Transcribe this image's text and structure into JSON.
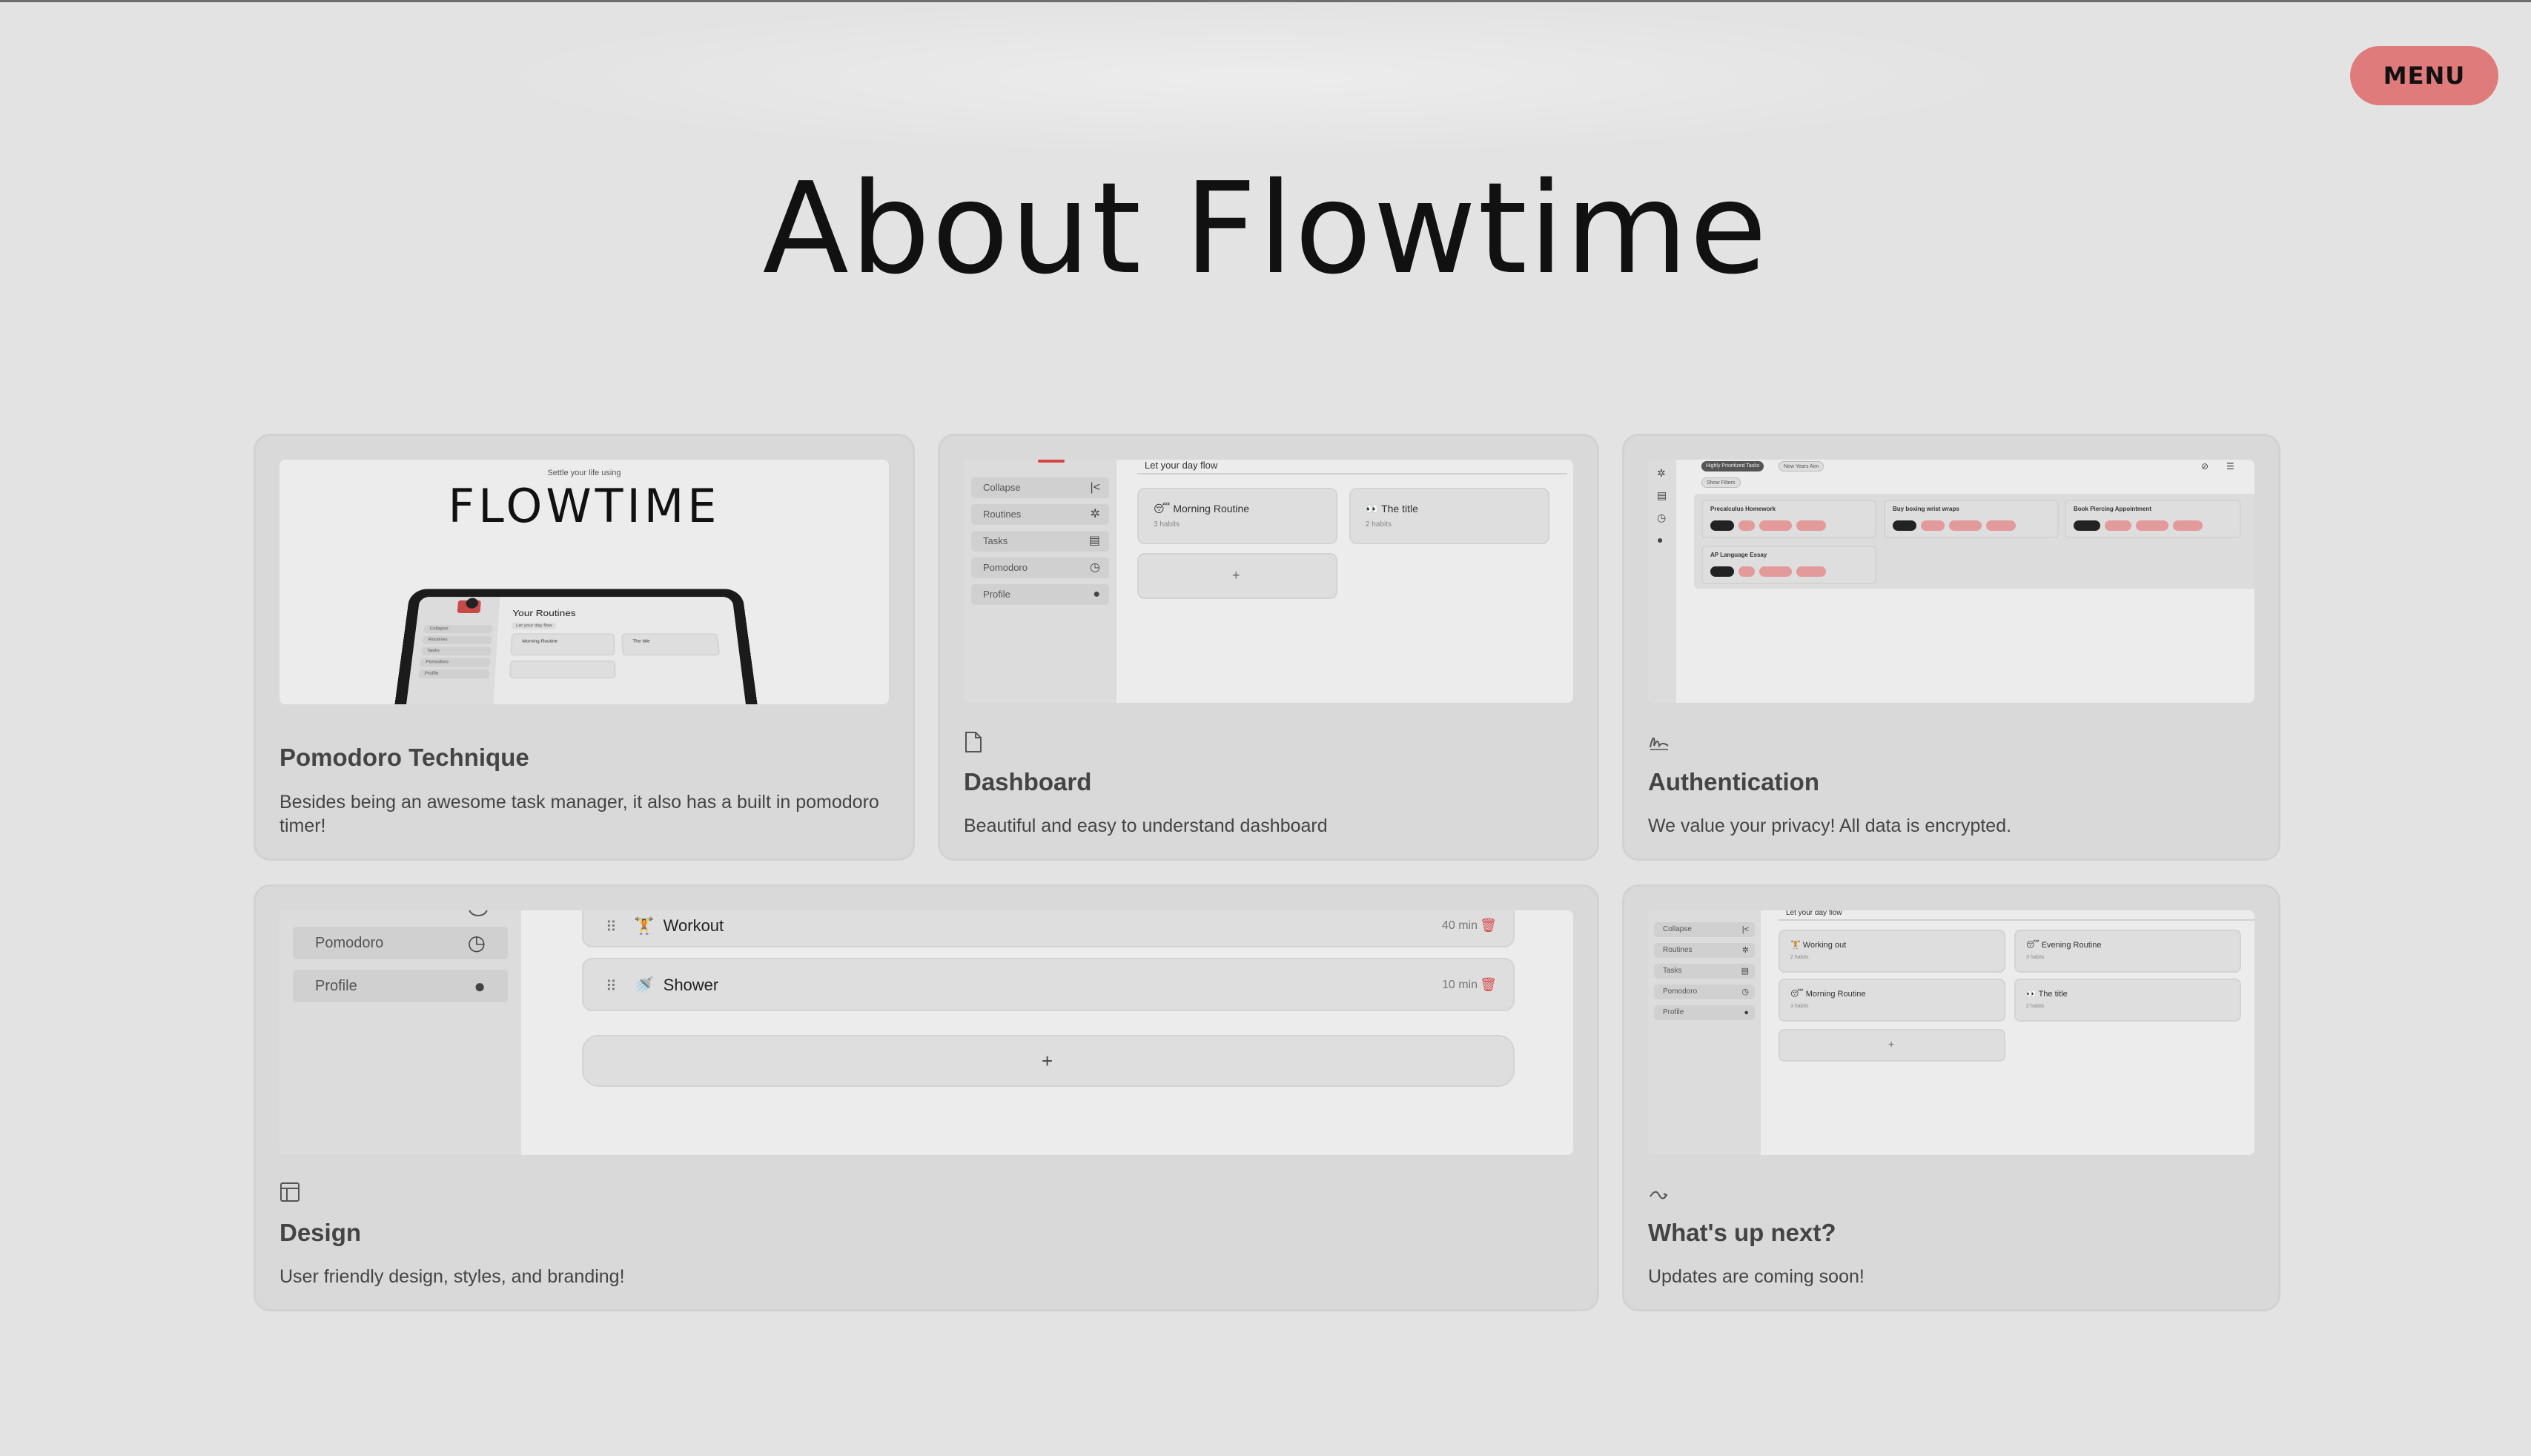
{
  "header": {
    "menu_label": "MENU",
    "title": "About Flowtime"
  },
  "colors": {
    "background": "#e3e3e3",
    "card": "#d9d9d9",
    "menu_button": "#e07b7b",
    "accent_red": "#d64545"
  },
  "cards": [
    {
      "title": "Pomodoro Technique",
      "description": "Besides being an awesome task manager, it also has a built in pomodoro timer!",
      "preview": {
        "tagline": "Settle your life using",
        "brand": "FLOWTIME",
        "screen_title": "Your Routines",
        "screen_subtitle": "Let your day flow",
        "sidebar": [
          "Collapse",
          "Routines",
          "Tasks",
          "Pomodoro",
          "Profile"
        ],
        "tiles": [
          "Morning Routine",
          "The title"
        ]
      }
    },
    {
      "title": "Dashboard",
      "description": "Beautiful and easy to understand dashboard",
      "icon": "document-icon",
      "preview": {
        "header": "Let your day flow",
        "sidebar": [
          "Collapse",
          "Routines",
          "Tasks",
          "Pomodoro",
          "Profile"
        ],
        "tiles": [
          {
            "emoji": "😴",
            "name": "Morning Routine",
            "sub": "3 habits"
          },
          {
            "emoji": "👀",
            "name": "The title",
            "sub": "2 habits"
          }
        ],
        "add": "+"
      }
    },
    {
      "title": "Authentication",
      "description": "We value your privacy! All data is encrypted.",
      "icon": "signature-icon",
      "preview": {
        "filters": [
          "Highly Prioritized Tasks",
          "New Years Aim"
        ],
        "show_filters": "Show Filters",
        "tasks": [
          "Precalculus Homework",
          "Buy boxing wrist wraps",
          "Book Piercing Appointment",
          "AP Language Essay"
        ]
      }
    },
    {
      "title": "Design",
      "description": "User friendly design, styles, and branding!",
      "icon": "layout-icon",
      "preview": {
        "sidebar": [
          "Pomodoro",
          "Profile"
        ],
        "rows": [
          {
            "emoji": "🏋",
            "name": "Workout",
            "time": "40 min"
          },
          {
            "emoji": "🚿",
            "name": "Shower",
            "time": "10 min"
          }
        ],
        "add": "+"
      }
    },
    {
      "title": "What's up next?",
      "description": "Updates are coming soon!",
      "icon": "squiggle-icon",
      "preview": {
        "header": "Let your day flow",
        "sidebar": [
          "Collapse",
          "Routines",
          "Tasks",
          "Pomodoro",
          "Profile"
        ],
        "tiles": [
          {
            "emoji": "🏋",
            "name": "Working out",
            "sub": "2 habits"
          },
          {
            "emoji": "😴",
            "name": "Evening Routine",
            "sub": "3 habits"
          },
          {
            "emoji": "😴",
            "name": "Morning Routine",
            "sub": "3 habits"
          },
          {
            "emoji": "👀",
            "name": "The title",
            "sub": "2 habits"
          }
        ],
        "add": "+"
      }
    }
  ]
}
